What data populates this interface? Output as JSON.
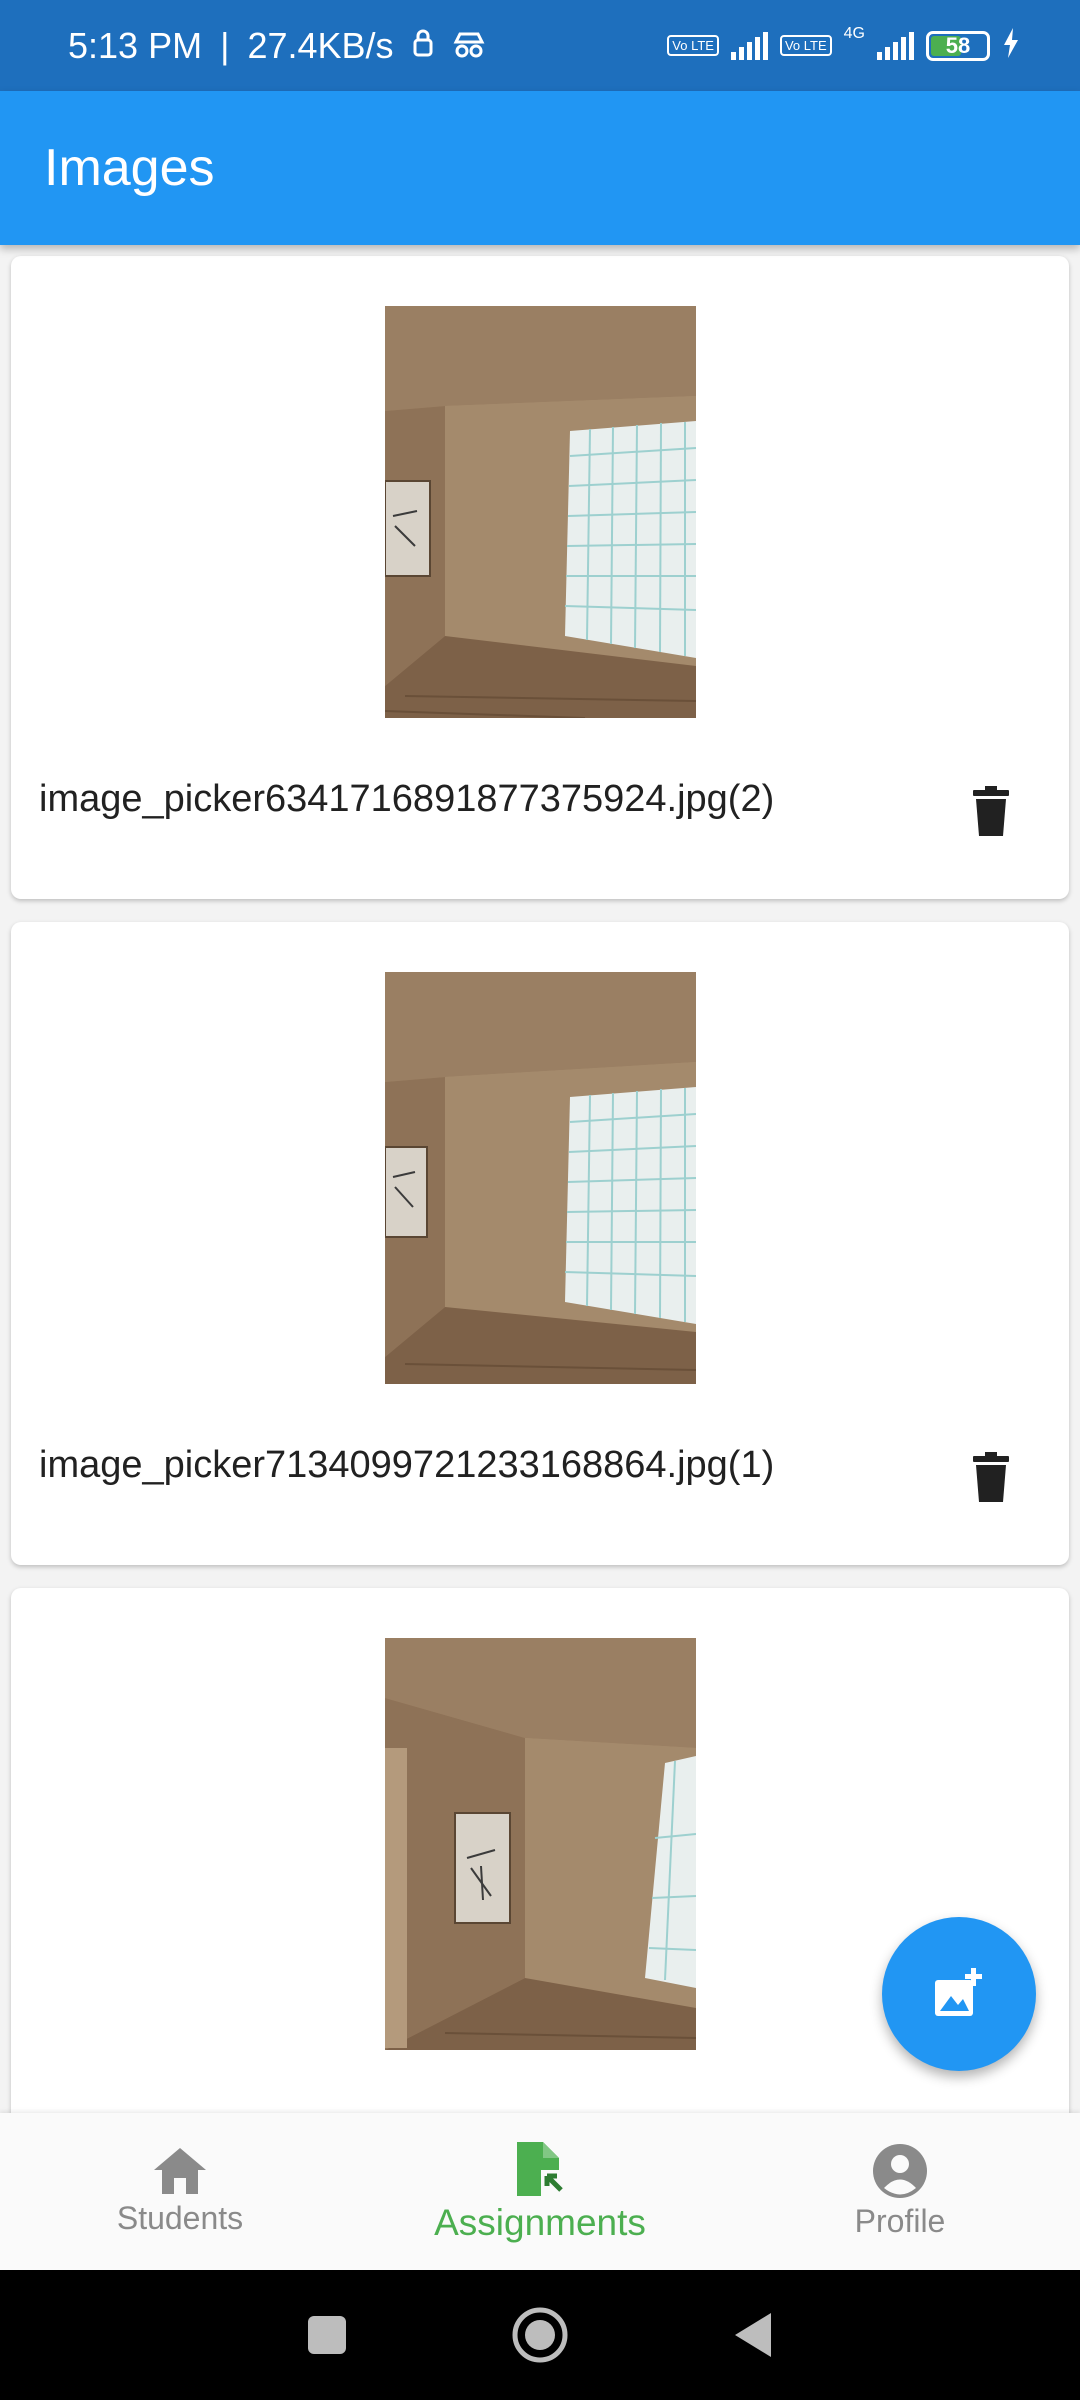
{
  "status_bar": {
    "time": "5:13 PM",
    "separator": "|",
    "speed": "27.4KB/s",
    "volte1": "Vo LTE",
    "volte2": "Vo LTE",
    "network": "4G",
    "battery": "58"
  },
  "app_bar": {
    "title": "Images"
  },
  "images": [
    {
      "name": "image_picker6341716891877375924.jpg(2)"
    },
    {
      "name": "image_picker7134099721233168864.jpg(1)"
    },
    {
      "name": ""
    }
  ],
  "fab": {
    "icon": "add-photo-icon"
  },
  "bottom_nav": {
    "items": [
      {
        "label": "Students",
        "icon": "home-icon",
        "active": false
      },
      {
        "label": "Assignments",
        "icon": "assignment-file-icon",
        "active": true
      },
      {
        "label": "Profile",
        "icon": "account-circle-icon",
        "active": false
      }
    ]
  },
  "colors": {
    "status_bar": "#1e6fbd",
    "primary": "#2196f3",
    "active_nav": "#4caf50",
    "inactive_nav": "#8a8a8a"
  }
}
